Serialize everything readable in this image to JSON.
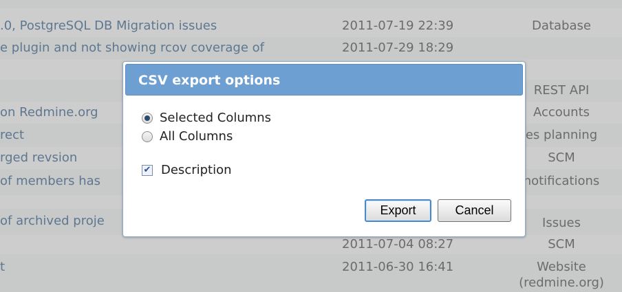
{
  "rows": [
    {
      "subject": "",
      "date": "",
      "category": ""
    },
    {
      "subject": ".0, PostgreSQL DB Migration issues",
      "date": "2011-07-19 22:39",
      "category": "Database"
    },
    {
      "subject": "e plugin and not showing rcov coverage of",
      "date": "2011-07-29 18:29",
      "category": ""
    },
    {
      "subject": "",
      "date": "",
      "category": ""
    },
    {
      "subject": "",
      "date": "",
      "category": "REST API"
    },
    {
      "subject": " on Redmine.org",
      "date": "",
      "category": "Accounts"
    },
    {
      "subject": "rect",
      "date": "",
      "category": "es planning"
    },
    {
      "subject": "rged revsion",
      "date": "",
      "category": "SCM"
    },
    {
      "subject": "of members has",
      "date": "",
      "category": "notifications"
    },
    {
      "subject": "",
      "date": "",
      "category": ""
    },
    {
      "subject": "of archived proje",
      "date": "",
      "category": "Issues"
    },
    {
      "subject": "",
      "date": "2011-07-04 08:27",
      "category": "SCM"
    },
    {
      "subject": "t",
      "date": "2011-06-30 16:41",
      "category": "Website"
    },
    {
      "subject": "",
      "date": "",
      "category": "(redmine.org)"
    }
  ],
  "dialog": {
    "title": "CSV export options",
    "option_selected": "Selected Columns",
    "option_all": "All Columns",
    "checkbox_description": "Description",
    "export_label": "Export",
    "cancel_label": "Cancel"
  }
}
